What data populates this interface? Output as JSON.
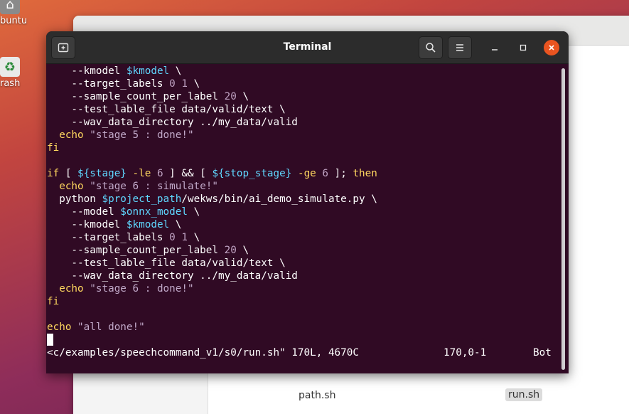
{
  "desktop": {
    "home_label": "buntu",
    "trash_label": "rash"
  },
  "files": {
    "items": [
      "path.sh",
      "run.sh"
    ]
  },
  "terminal": {
    "title": "Terminal",
    "lines": [
      [
        {
          "t": "    --kmodel "
        },
        {
          "t": "$kmodel",
          "c": "var"
        },
        {
          "t": " \\"
        }
      ],
      [
        {
          "t": "    --target_labels "
        },
        {
          "t": "0 1",
          "c": "num"
        },
        {
          "t": " \\"
        }
      ],
      [
        {
          "t": "    --sample_count_per_label "
        },
        {
          "t": "20",
          "c": "num"
        },
        {
          "t": " \\"
        }
      ],
      [
        {
          "t": "    --test_lable_file data/valid/text \\"
        }
      ],
      [
        {
          "t": "    --wav_data_directory ../my_data/valid"
        }
      ],
      [
        {
          "t": "  "
        },
        {
          "t": "echo",
          "c": "kw"
        },
        {
          "t": " "
        },
        {
          "t": "\"stage 5 : done!\"",
          "c": "str"
        }
      ],
      [
        {
          "t": "fi",
          "c": "kw"
        }
      ],
      [
        {
          "t": ""
        }
      ],
      [
        {
          "t": "if",
          "c": "kw"
        },
        {
          "t": " [ "
        },
        {
          "t": "${stage}",
          "c": "var"
        },
        {
          "t": " "
        },
        {
          "t": "-le",
          "c": "kw"
        },
        {
          "t": " "
        },
        {
          "t": "6",
          "c": "num"
        },
        {
          "t": " ] && [ "
        },
        {
          "t": "${stop_stage}",
          "c": "var"
        },
        {
          "t": " "
        },
        {
          "t": "-ge",
          "c": "kw"
        },
        {
          "t": " "
        },
        {
          "t": "6",
          "c": "num"
        },
        {
          "t": " ]; "
        },
        {
          "t": "then",
          "c": "kw"
        }
      ],
      [
        {
          "t": "  "
        },
        {
          "t": "echo",
          "c": "kw"
        },
        {
          "t": " "
        },
        {
          "t": "\"stage 6 : simulate!\"",
          "c": "str"
        }
      ],
      [
        {
          "t": "  python "
        },
        {
          "t": "$project_path",
          "c": "var"
        },
        {
          "t": "/wekws/bin/ai_demo_simulate.py \\"
        }
      ],
      [
        {
          "t": "    --model "
        },
        {
          "t": "$onnx_model",
          "c": "var"
        },
        {
          "t": " \\"
        }
      ],
      [
        {
          "t": "    --kmodel "
        },
        {
          "t": "$kmodel",
          "c": "var"
        },
        {
          "t": " \\"
        }
      ],
      [
        {
          "t": "    --target_labels "
        },
        {
          "t": "0 1",
          "c": "num"
        },
        {
          "t": " \\"
        }
      ],
      [
        {
          "t": "    --sample_count_per_label "
        },
        {
          "t": "20",
          "c": "num"
        },
        {
          "t": " \\"
        }
      ],
      [
        {
          "t": "    --test_lable_file data/valid/text \\"
        }
      ],
      [
        {
          "t": "    --wav_data_directory ../my_data/valid"
        }
      ],
      [
        {
          "t": "  "
        },
        {
          "t": "echo",
          "c": "kw"
        },
        {
          "t": " "
        },
        {
          "t": "\"stage 6 : done!\"",
          "c": "str"
        }
      ],
      [
        {
          "t": "fi",
          "c": "kw"
        }
      ],
      [
        {
          "t": ""
        }
      ],
      [
        {
          "t": "echo",
          "c": "kw"
        },
        {
          "t": " "
        },
        {
          "t": "\"all done!\"",
          "c": "str"
        }
      ],
      [
        {
          "t": ""
        }
      ]
    ],
    "status": {
      "file": "<c/examples/speechcommand_v1/s0/run.sh\" 170L, 4670C",
      "position": "170,0-1",
      "scroll": "Bot"
    }
  }
}
